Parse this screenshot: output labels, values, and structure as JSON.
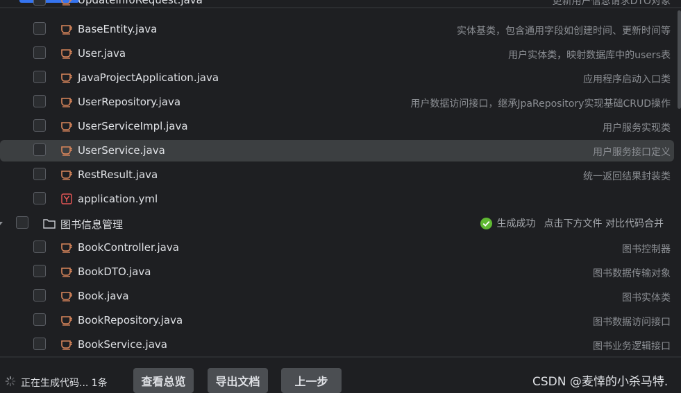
{
  "files": [
    {
      "name": "UpdateInfoRequest.java",
      "desc": "更新用户信息请求DTO对象",
      "icon": "java-file-icon",
      "partial": true
    },
    {
      "name": "BaseEntity.java",
      "desc": "实体基类，包含通用字段如创建时间、更新时间等",
      "icon": "java-file-icon"
    },
    {
      "name": "User.java",
      "desc": "用户实体类，映射数据库中的users表",
      "icon": "java-file-icon"
    },
    {
      "name": "JavaProjectApplication.java",
      "desc": "应用程序启动入口类",
      "icon": "java-file-icon"
    },
    {
      "name": "UserRepository.java",
      "desc": "用户数据访问接口，继承JpaRepository实现基础CRUD操作",
      "icon": "java-file-icon"
    },
    {
      "name": "UserServiceImpl.java",
      "desc": "用户服务实现类",
      "icon": "java-file-icon"
    },
    {
      "name": "UserService.java",
      "desc": "用户服务接口定义",
      "icon": "java-file-icon",
      "selected": true
    },
    {
      "name": "RestResult.java",
      "desc": "统一返回结果封装类",
      "icon": "java-file-icon"
    },
    {
      "name": "application.yml",
      "desc": "",
      "icon": "yaml-file-icon"
    }
  ],
  "folder": {
    "name": "图书信息管理",
    "status_text": "生成成功",
    "hint": "点击下方文件 对比代码合并",
    "icon": "folder-icon"
  },
  "folder_files": [
    {
      "name": "BookController.java",
      "desc": "图书控制器",
      "icon": "java-file-icon"
    },
    {
      "name": "BookDTO.java",
      "desc": "图书数据传输对象",
      "icon": "java-file-icon"
    },
    {
      "name": "Book.java",
      "desc": "图书实体类",
      "icon": "java-file-icon"
    },
    {
      "name": "BookRepository.java",
      "desc": "图书数据访问接口",
      "icon": "java-file-icon"
    },
    {
      "name": "BookService.java",
      "desc": "图书业务逻辑接口",
      "icon": "java-file-icon"
    }
  ],
  "footer": {
    "progress": "正在生成代码... 1条",
    "buttons": [
      "查看总览",
      "导出文档",
      "上一步"
    ],
    "watermark": "CSDN @麦悻的小杀马特."
  },
  "colors": {
    "java_icon": "#d9865b",
    "yaml_icon": "#e05555",
    "success": "#5fb832",
    "accent": "#3574f0"
  }
}
